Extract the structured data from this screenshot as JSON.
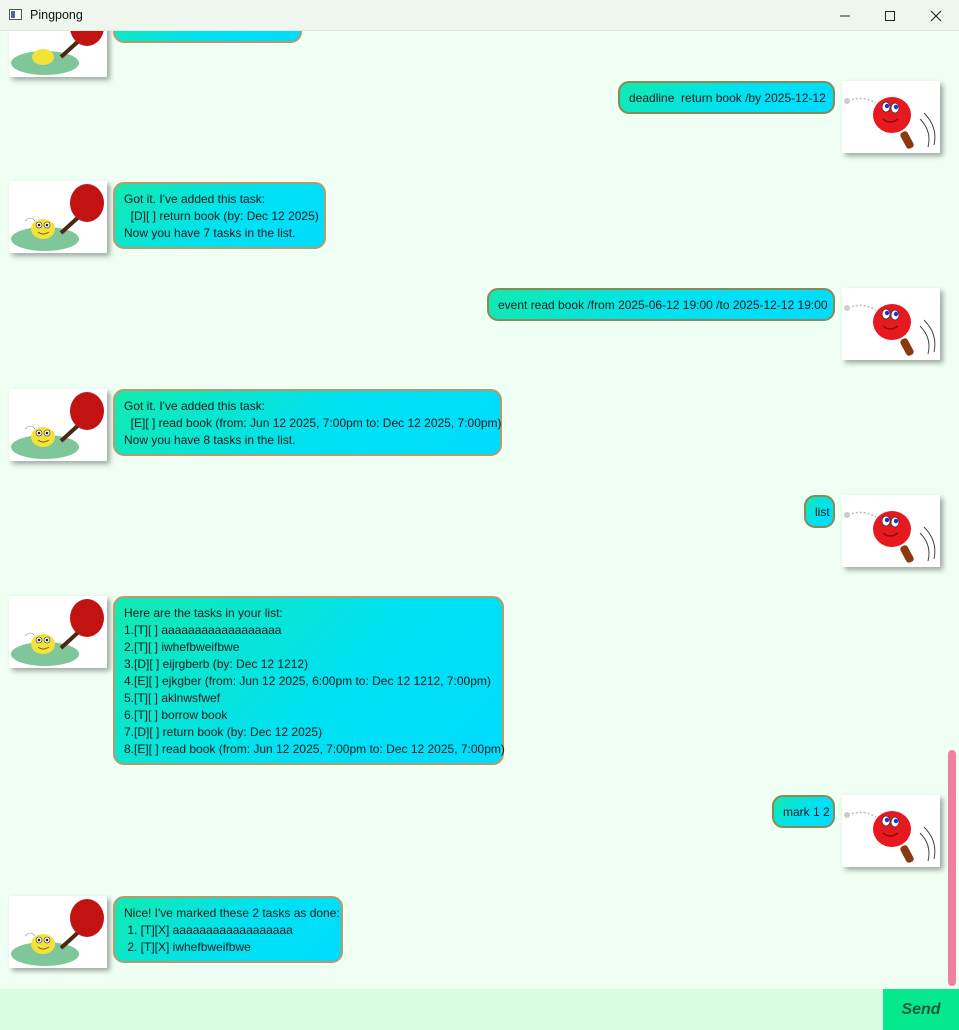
{
  "window": {
    "title": "Pingpong",
    "minimize_icon": "minimize-icon",
    "maximize_icon": "maximize-icon",
    "close_icon": "close-icon"
  },
  "chat": {
    "messages": [
      {
        "sender": "bot",
        "avatar": "frog-paddle-avatar",
        "text": ""
      },
      {
        "sender": "user",
        "avatar": "pingpong-paddle-avatar",
        "text": "deadline  return book /by 2025-12-12"
      },
      {
        "sender": "bot",
        "avatar": "frog-paddle-avatar",
        "text": "Got it. I've added this task:\n  [D][ ] return book (by: Dec 12 2025)\nNow you have 7 tasks in the list."
      },
      {
        "sender": "user",
        "avatar": "pingpong-paddle-avatar",
        "text": "event read book /from 2025-06-12 19:00 /to 2025-12-12 19:00"
      },
      {
        "sender": "bot",
        "avatar": "frog-paddle-avatar",
        "text": "Got it. I've added this task:\n  [E][ ] read book (from: Jun 12 2025, 7:00pm to: Dec 12 2025, 7:00pm)\nNow you have 8 tasks in the list."
      },
      {
        "sender": "user",
        "avatar": "pingpong-paddle-avatar",
        "text": "list"
      },
      {
        "sender": "bot",
        "avatar": "frog-paddle-avatar",
        "text": "Here are the tasks in your list:\n1.[T][ ] aaaaaaaaaaaaaaaaaa\n2.[T][ ] iwhefbweifbwe\n3.[D][ ] eijrgberb (by: Dec 12 1212)\n4.[E][ ] ejkgber (from: Jun 12 2025, 6:00pm to: Dec 12 1212, 7:00pm)\n5.[T][ ] aklnwsfwef\n6.[T][ ] borrow book\n7.[D][ ] return book (by: Dec 12 2025)\n8.[E][ ] read book (from: Jun 12 2025, 7:00pm to: Dec 12 2025, 7:00pm)"
      },
      {
        "sender": "user",
        "avatar": "pingpong-paddle-avatar",
        "text": "mark 1 2"
      },
      {
        "sender": "bot",
        "avatar": "frog-paddle-avatar",
        "text": "Nice! I've marked these 2 tasks as done:\n 1. [T][X] aaaaaaaaaaaaaaaaaa\n 2. [T][X] iwhefbweifbwe"
      }
    ]
  },
  "input": {
    "value": "",
    "placeholder": ""
  },
  "send_button": {
    "label": "Send"
  },
  "colors": {
    "background": "#f0fff4",
    "bubble_gradient_start": "#12eab0",
    "bubble_gradient_end": "#00dcff",
    "send_button": "#05e88d",
    "scrollbar": "#f27fa0"
  }
}
